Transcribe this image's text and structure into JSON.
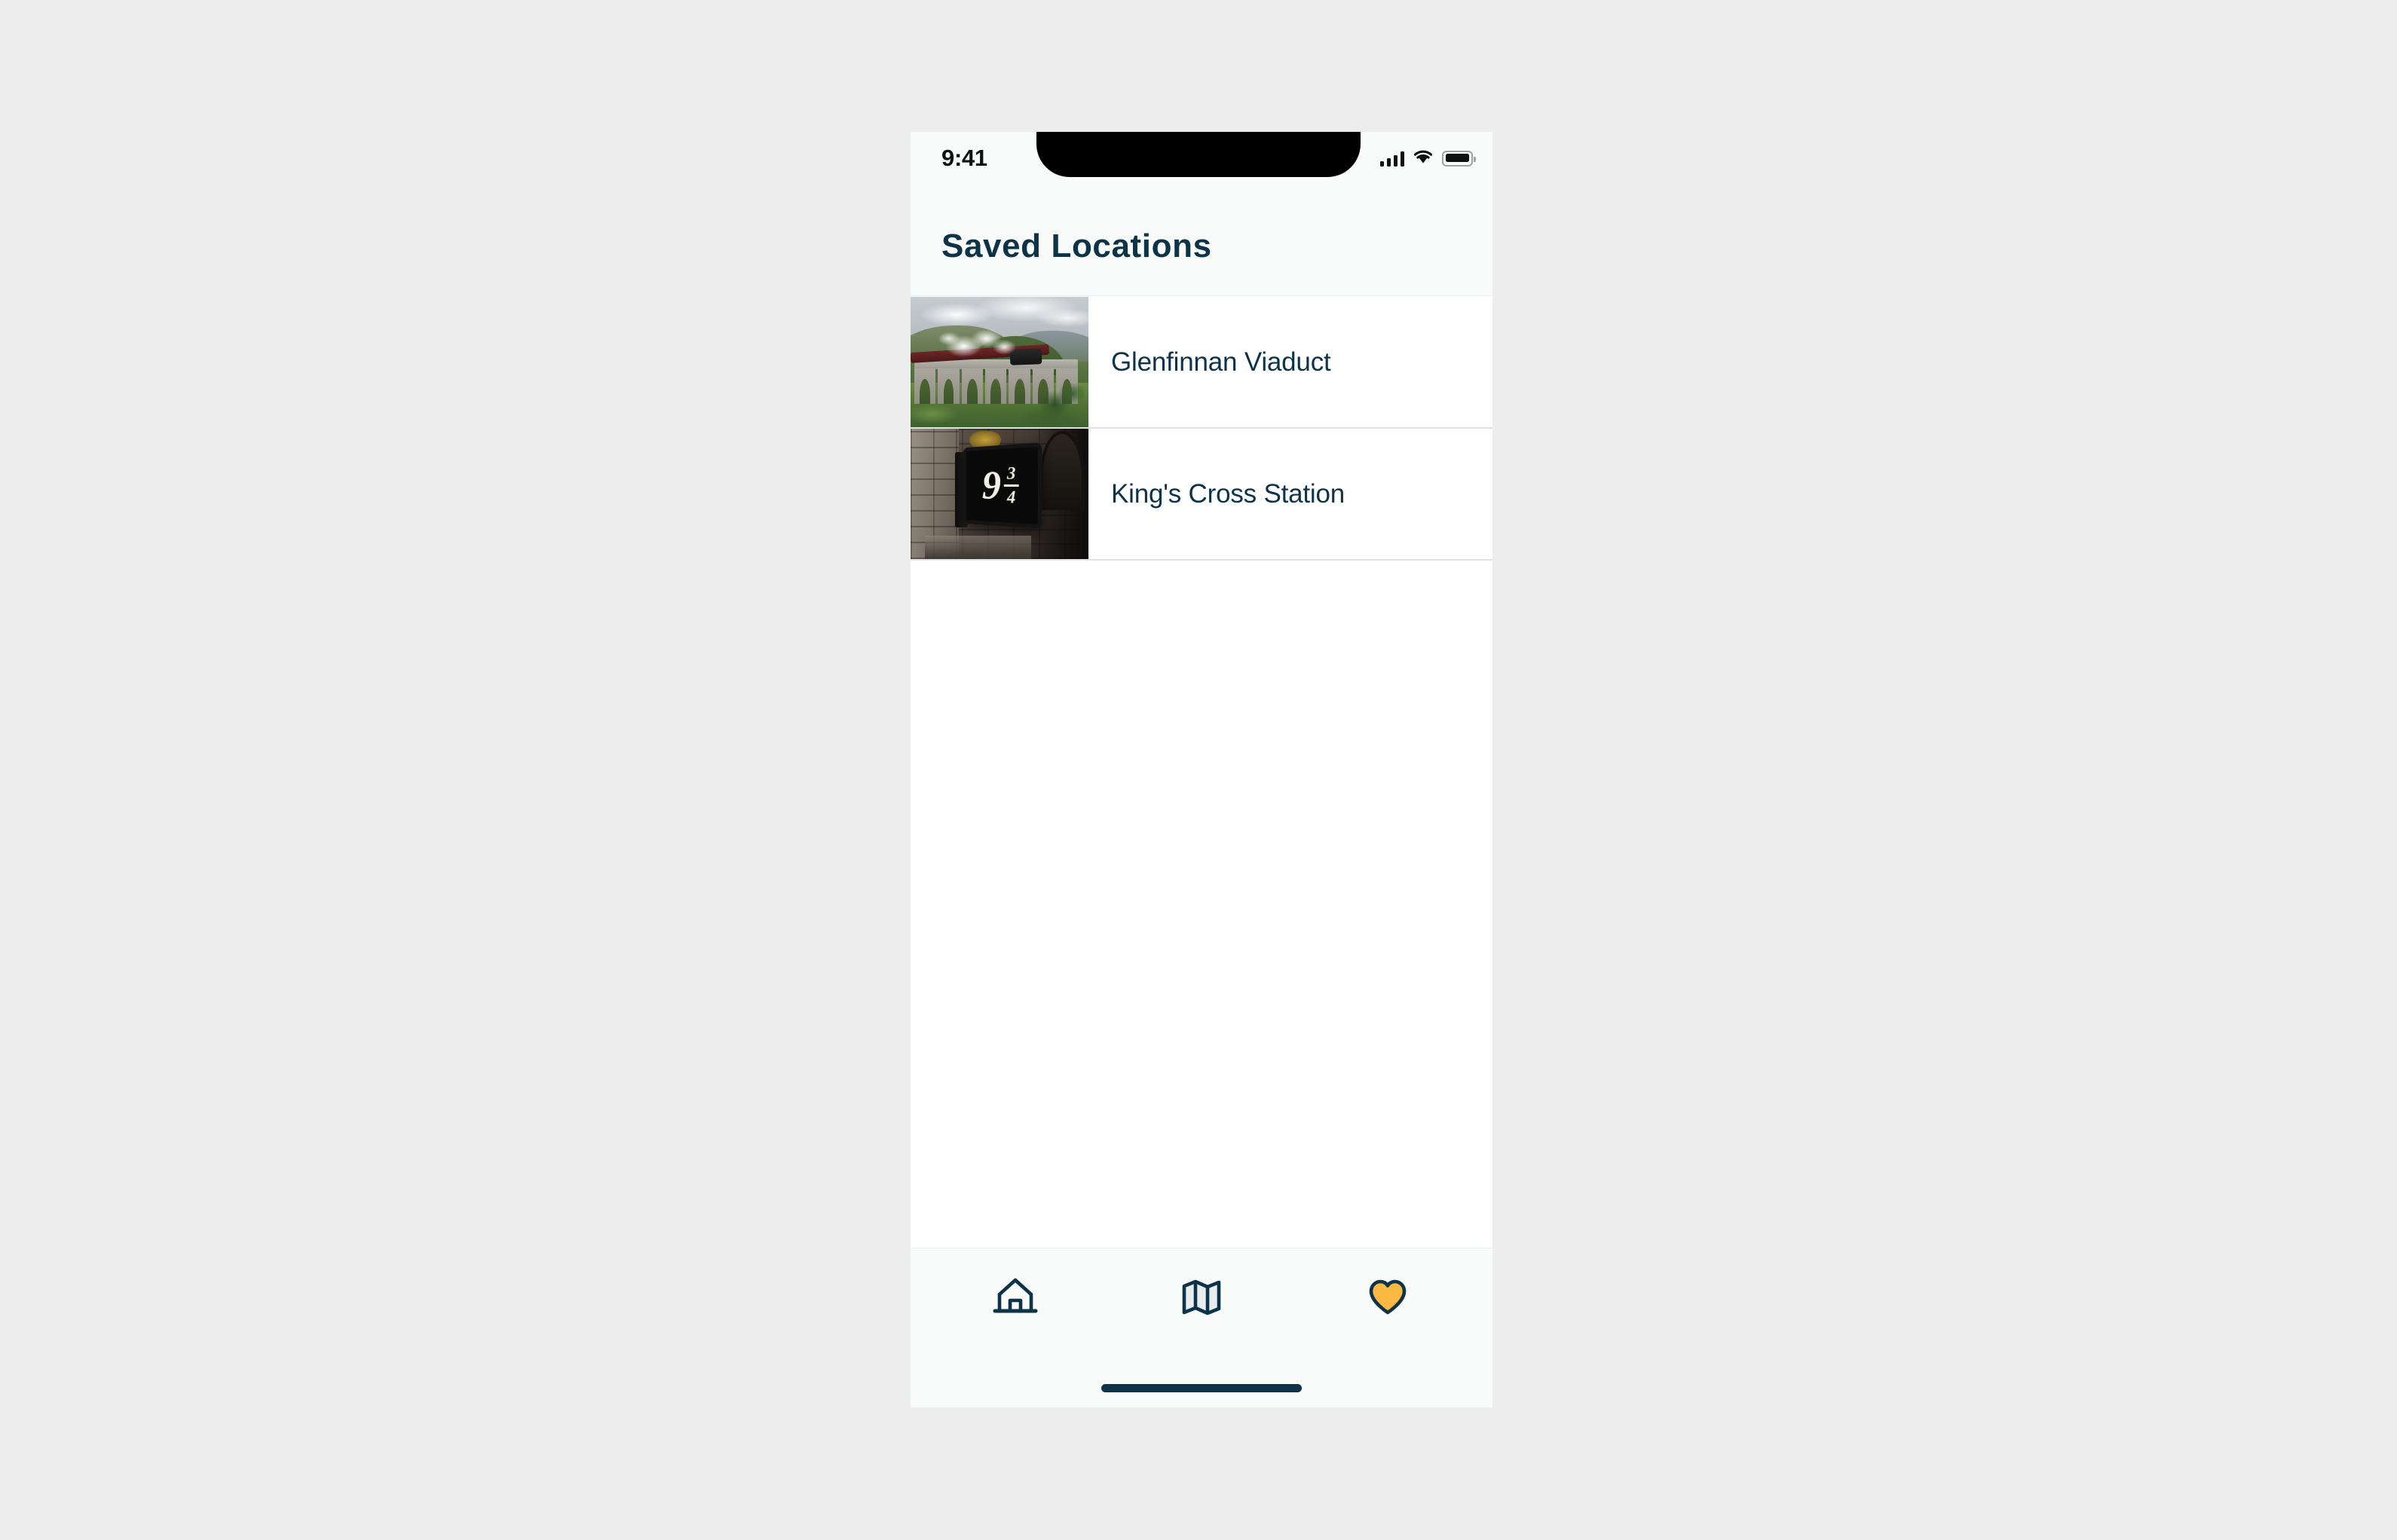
{
  "device": {
    "status_bar": {
      "time": "9:41",
      "icons": [
        "cellular-signal-icon",
        "wifi-icon",
        "battery-icon"
      ]
    },
    "home_indicator": true
  },
  "header": {
    "title": "Saved Locations"
  },
  "theme": {
    "navy": "#0d3349",
    "amber": "#f9b942",
    "page_background": "#ededed",
    "surface": "#ffffff",
    "chrome": "#f9fafa",
    "divider": "#e2e2e2"
  },
  "saved_locations": {
    "rows": [
      {
        "label": "Glenfinnan Viaduct",
        "thumbnail": "glenfinnan-viaduct-photo"
      },
      {
        "label": "King's Cross Station",
        "thumbnail": "platform-nine-three-quarters-photo"
      }
    ]
  },
  "tabbar": {
    "items": [
      {
        "icon": "home-icon",
        "name": "tab-home",
        "active": false
      },
      {
        "icon": "map-icon",
        "name": "tab-map",
        "active": false
      },
      {
        "icon": "heart-icon",
        "name": "tab-favorites",
        "active": true
      }
    ]
  }
}
